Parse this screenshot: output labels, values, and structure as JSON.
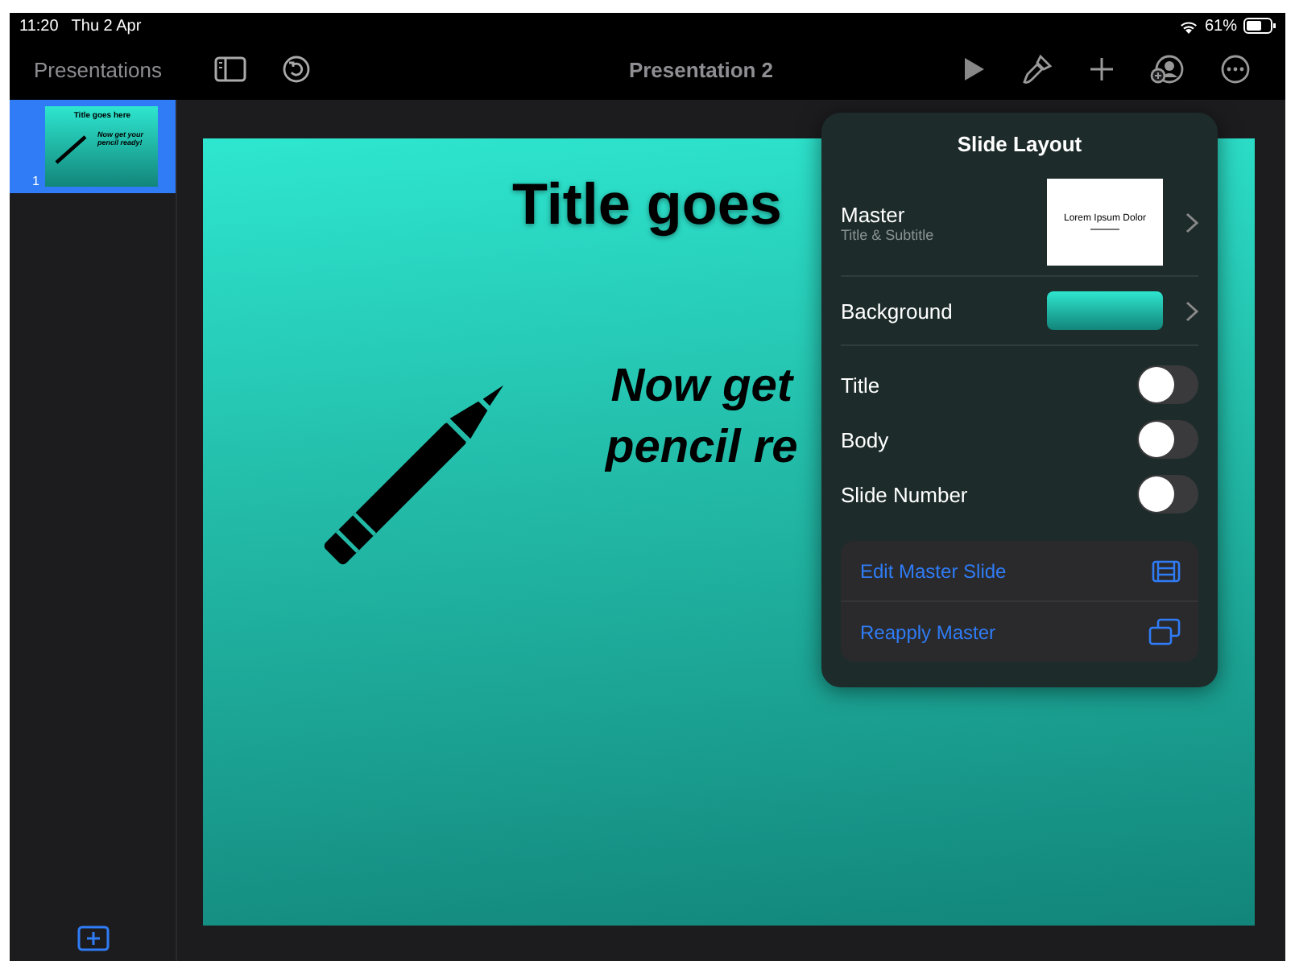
{
  "status": {
    "time": "11:20",
    "date": "Thu 2 Apr",
    "battery": "61%"
  },
  "toolbar": {
    "back": "Presentations",
    "title": "Presentation 2"
  },
  "slides": [
    {
      "number": "1",
      "selected": true,
      "title": "Title goes here",
      "body": "Now get your pencil ready!"
    }
  ],
  "slide": {
    "title": "Title goes",
    "body_lines": [
      "Now get",
      "pencil re"
    ]
  },
  "popover": {
    "title": "Slide Layout",
    "master": {
      "label": "Master",
      "sublabel": "Title & Subtitle",
      "preview_title": "Lorem Ipsum Dolor"
    },
    "background": {
      "label": "Background"
    },
    "toggles": [
      {
        "label": "Title",
        "on": false
      },
      {
        "label": "Body",
        "on": false
      },
      {
        "label": "Slide Number",
        "on": false
      }
    ],
    "actions": [
      {
        "label": "Edit Master Slide",
        "kind": "edit"
      },
      {
        "label": "Reapply Master",
        "kind": "reapply"
      }
    ]
  }
}
